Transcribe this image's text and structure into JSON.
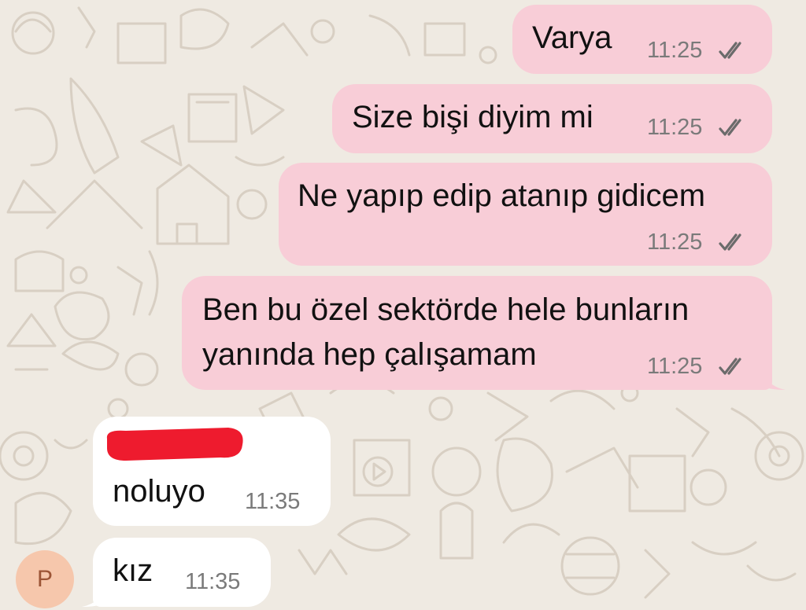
{
  "conversation": {
    "outgoing": [
      {
        "text": "Varya",
        "time": "11:25",
        "status": "read"
      },
      {
        "text": "Size bişi diyim mi",
        "time": "11:25",
        "status": "read"
      },
      {
        "text": "Ne yapıp edip atanıp gidicem",
        "time": "11:25",
        "status": "read"
      },
      {
        "line1": "Ben bu özel sektörde hele bunların",
        "line2": "yanında hep çalışamam",
        "time": "11:25",
        "status": "read"
      }
    ],
    "incoming": [
      {
        "sender_redacted": true,
        "text": "noluyo",
        "time": "11:35"
      },
      {
        "text": "kız",
        "time": "11:35"
      }
    ]
  },
  "sender": {
    "avatar_initial": "P"
  },
  "icons": {
    "read_receipt": "double-check-icon"
  },
  "colors": {
    "background": "#efeae2",
    "outgoing_bubble": "#f8cdd7",
    "incoming_bubble": "#ffffff",
    "redaction": "#ee1b2e",
    "avatar": "#f6c7ac"
  }
}
